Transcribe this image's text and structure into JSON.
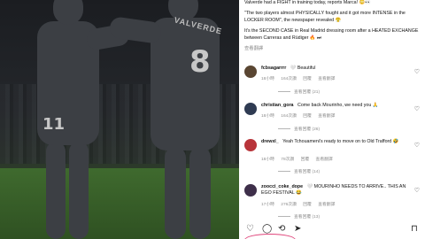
{
  "caption": {
    "line1": "Valverde had a FIGHT in training today, reports Marca! 😳👀",
    "line2": "\"The two players almost PHYSICALLY fought and it got more INTENSE in the LOCKER ROOM\", the newspaper revealed 😤",
    "line3": "It's the SECOND CASE in Real Madrid dressing room after a HEATED EXCHANGE between Carreras and Rüdiger 🔥 ⏭",
    "translate": "查看翻譯"
  },
  "comments": [
    {
      "user": "fcbsagarrrr",
      "text": "🤍 Beautiful",
      "time": "18小時",
      "likes": "164次讚",
      "reply": "回覆",
      "translate": "查看翻譯",
      "replies": "查看回覆 (21)",
      "avatar_color": "#5a4632"
    },
    {
      "user": "christian_gora",
      "text": "Come back Mourinho, we need you 🙏",
      "time": "18小時",
      "likes": "164次讚",
      "reply": "回覆",
      "translate": "查看翻譯",
      "replies": "查看回覆 (26)",
      "avatar_color": "#2f3b52"
    },
    {
      "user": "drewxl_",
      "text": "Yeah Tchouameni's ready to move on to Old Trafford 🤣",
      "time": "18小時",
      "likes": "78次讚",
      "reply": "回覆",
      "translate": "查看翻譯",
      "replies": "查看回覆 (14)",
      "avatar_color": "#b8343a"
    },
    {
      "user": "zoocci_coke_dope",
      "text": "🤍 MOURINHO NEEDS TO ARRIVE.. THIS AN EGO FESTIVAL 😂",
      "time": "17小時",
      "likes": "276次讚",
      "reply": "回覆",
      "translate": "查看翻譯",
      "replies": "查看回覆 (13)",
      "avatar_color": "#3e2f4a"
    }
  ],
  "photo": {
    "jersey_name": "VALVERDE",
    "num_right": "8",
    "num_left": "11"
  },
  "icons": {
    "like": "heart-icon",
    "comment": "comment-icon",
    "share": "share-icon",
    "repost": "repost-icon",
    "save": "bookmark-icon"
  },
  "colors": {
    "accent_ring": "#e0457b",
    "meta": "#8e8e8e"
  }
}
